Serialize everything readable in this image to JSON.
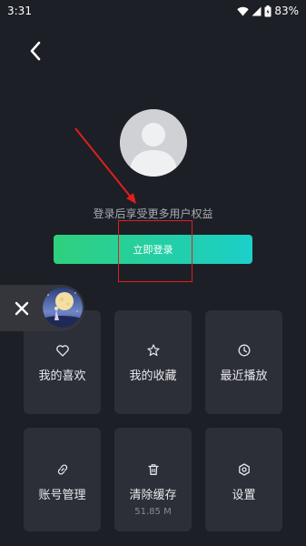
{
  "status_bar": {
    "time": "3:31",
    "battery": "83%"
  },
  "icons": {
    "back": "chevron-left-icon",
    "avatar": "default-user-avatar-icon",
    "close": "close-icon",
    "favorite": "heart-icon",
    "collection": "star-icon",
    "recent": "clock-icon",
    "account": "link-icon",
    "cache": "trash-icon",
    "settings": "gear-icon"
  },
  "profile": {
    "login_tip": "登录后享受更多用户权益",
    "login_button": "立即登录"
  },
  "menu": {
    "favorites": "我的喜欢",
    "collection": "我的收藏",
    "recent": "最近播放",
    "account": "账号管理",
    "clear_cache": "清除缓存",
    "cache_size": "51.85 M",
    "settings": "设置"
  },
  "colors": {
    "background": "#1d1f26",
    "tile": "#2c2f37",
    "login_gradient_start": "#2fd07d",
    "login_gradient_end": "#1ccfc9",
    "annotation": "#e01e1e"
  }
}
